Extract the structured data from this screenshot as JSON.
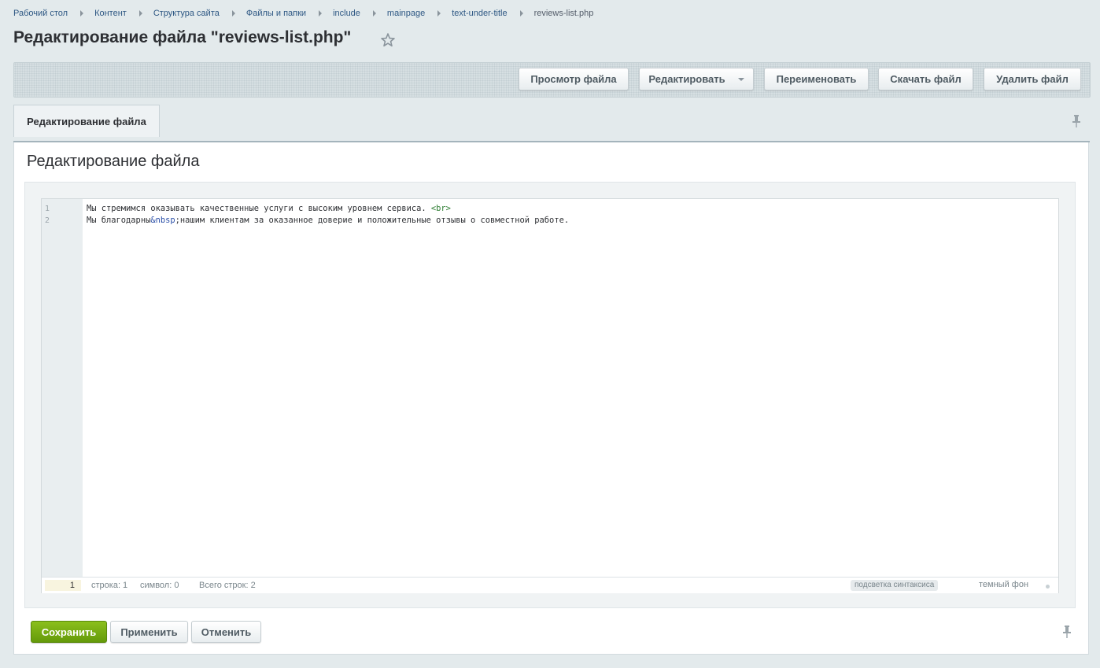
{
  "breadcrumb": {
    "items": [
      "Рабочий стол",
      "Контент",
      "Структура сайта",
      "Файлы и папки",
      "include",
      "mainpage",
      "text-under-title"
    ],
    "current": "reviews-list.php"
  },
  "page": {
    "title": "Редактирование файла \"reviews-list.php\"",
    "favorite_icon": "star-outline-icon"
  },
  "toolbar": {
    "view_label": "Просмотр файла",
    "edit_label": "Редактировать",
    "rename_label": "Переименовать",
    "download_label": "Скачать файл",
    "delete_label": "Удалить файл"
  },
  "tabs": [
    {
      "label": "Редактирование файла",
      "active": true
    }
  ],
  "section": {
    "title": "Редактирование файла"
  },
  "editor": {
    "lines": [
      {
        "num": "1",
        "text": "Мы стремимся оказывать качественные услуги с высоким уровнем сервиса. ",
        "tag": "<br>"
      },
      {
        "num": "2",
        "before": "Мы благодарны",
        "entity_amp": "&",
        "entity_name": "nbsp",
        "after": ";нашим клиентам за оказанное доверие и положительные отзывы о совместной работе."
      }
    ],
    "status": {
      "current_line_value": "1",
      "line_label": "строка: 1",
      "char_label": "символ: 0",
      "total_label": "Всего строк: 2",
      "syntax_label": "подсветка синтаксиса",
      "dark_label": "темный фон"
    }
  },
  "actions": {
    "save_label": "Сохранить",
    "apply_label": "Применить",
    "cancel_label": "Отменить"
  },
  "colors": {
    "accent_green": "#7cb213",
    "link_blue": "#2d5783",
    "background": "#e3eaec"
  }
}
